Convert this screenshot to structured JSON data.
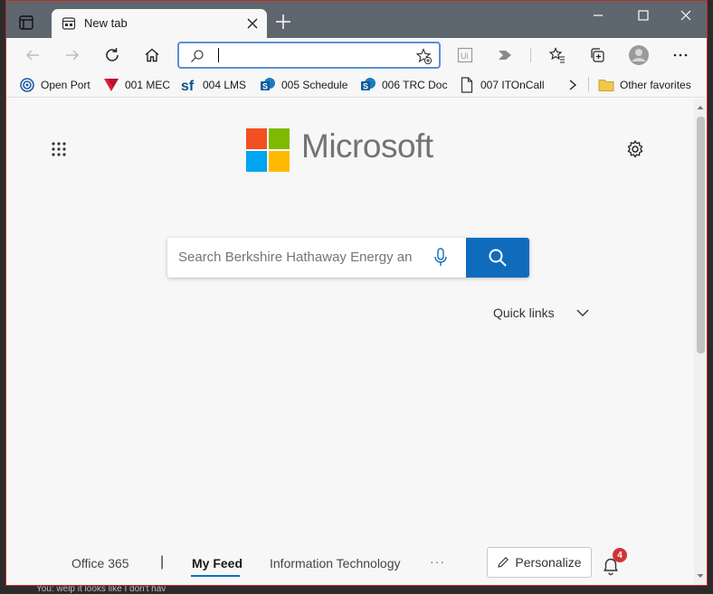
{
  "browser": {
    "tab_title": "New tab",
    "address_value": "",
    "colors": {
      "titlebar": "#5e6670",
      "accent": "#0f6cbd",
      "window_border": "#c42b1c"
    }
  },
  "favorites": [
    {
      "label": "Open Port",
      "icon": "open-port-icon"
    },
    {
      "label": "001 MEC",
      "icon": "mec-icon"
    },
    {
      "label": "004 LMS",
      "icon": "salesforce-sf-icon"
    },
    {
      "label": "005 Schedule",
      "icon": "sharepoint-icon"
    },
    {
      "label": "006 TRC Doc",
      "icon": "sharepoint-icon"
    },
    {
      "label": "007 ITOnCall",
      "icon": "page-icon"
    },
    {
      "label": "Other favorites",
      "icon": "folder-icon"
    }
  ],
  "newtab": {
    "brand": "Microsoft",
    "search_placeholder": "Search Berkshire Hathaway Energy an",
    "quick_links": "Quick links",
    "feed_tabs": [
      "Office 365",
      "My Feed",
      "Information Technology"
    ],
    "active_feed_tab": "My Feed",
    "more": "···",
    "personalize": "Personalize",
    "notification_count": "4"
  },
  "background": {
    "chat_snippet": "You:   welp it looks like I don't hav"
  }
}
